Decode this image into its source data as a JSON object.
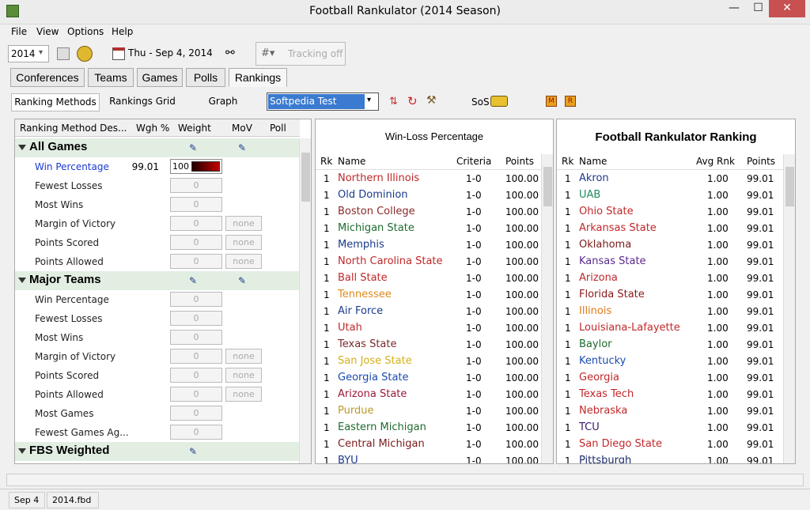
{
  "window": {
    "title": "Football Rankulator  (2014 Season)",
    "min": "—",
    "max": "☐",
    "close": "✕"
  },
  "menu": [
    "File",
    "View",
    "Options",
    "Help"
  ],
  "toolbar": {
    "season": "2014",
    "date": "Thu - Sep 4, 2014",
    "tracking": "Tracking off"
  },
  "main_tabs": [
    "Conferences",
    "Teams",
    "Games",
    "Polls",
    "Rankings"
  ],
  "sub_tabs": [
    "Ranking Methods",
    "Rankings Grid",
    "Graph"
  ],
  "method_select": "Softpedia Test",
  "sos_label": "SoS",
  "methods_header": [
    "Ranking Method Des...",
    "Wgh %",
    "Weight",
    "MoV",
    "Poll"
  ],
  "groups": [
    {
      "name": "All Games",
      "items": [
        {
          "label": "Win Percentage",
          "pct": "99.01",
          "weight": "100",
          "none": false,
          "active": true
        },
        {
          "label": "Fewest Losses",
          "weight": "0",
          "none": false
        },
        {
          "label": "Most Wins",
          "weight": "0",
          "none": false
        },
        {
          "label": "Margin of Victory",
          "weight": "0",
          "none": true
        },
        {
          "label": "Points Scored",
          "weight": "0",
          "none": true
        },
        {
          "label": "Points Allowed",
          "weight": "0",
          "none": true
        }
      ]
    },
    {
      "name": "Major Teams",
      "items": [
        {
          "label": "Win Percentage",
          "weight": "0",
          "none": false
        },
        {
          "label": "Fewest Losses",
          "weight": "0",
          "none": false
        },
        {
          "label": "Most Wins",
          "weight": "0",
          "none": false
        },
        {
          "label": "Margin of Victory",
          "weight": "0",
          "none": true
        },
        {
          "label": "Points Scored",
          "weight": "0",
          "none": true
        },
        {
          "label": "Points Allowed",
          "weight": "0",
          "none": true
        },
        {
          "label": "Most Games",
          "weight": "0",
          "none": false
        },
        {
          "label": "Fewest Games Ag...",
          "weight": "0",
          "none": false
        }
      ]
    },
    {
      "name": "FBS Weighted",
      "items": []
    }
  ],
  "none_label": "none",
  "wl": {
    "title": "Win-Loss Percentage",
    "headers": [
      "Rk",
      "Name",
      "Criteria",
      "Points"
    ],
    "rows": [
      [
        "1",
        "Northern Illinois",
        "1-0",
        "100.00",
        "#c0282a"
      ],
      [
        "1",
        "Old Dominion",
        "1-0",
        "100.00",
        "#1a3a8c"
      ],
      [
        "1",
        "Boston College",
        "1-0",
        "100.00",
        "#8b2a2a"
      ],
      [
        "1",
        "Michigan State",
        "1-0",
        "100.00",
        "#1e6b2e"
      ],
      [
        "1",
        "Memphis",
        "1-0",
        "100.00",
        "#1a3a8c"
      ],
      [
        "1",
        "North Carolina State",
        "1-0",
        "100.00",
        "#c0282a"
      ],
      [
        "1",
        "Ball State",
        "1-0",
        "100.00",
        "#c0282a"
      ],
      [
        "1",
        "Tennessee",
        "1-0",
        "100.00",
        "#e08a1a"
      ],
      [
        "1",
        "Air Force",
        "1-0",
        "100.00",
        "#1a3a8c"
      ],
      [
        "1",
        "Utah",
        "1-0",
        "100.00",
        "#c0282a"
      ],
      [
        "1",
        "Texas State",
        "1-0",
        "100.00",
        "#7a2a2a"
      ],
      [
        "1",
        "San Jose State",
        "1-0",
        "100.00",
        "#d4b01a"
      ],
      [
        "1",
        "Georgia State",
        "1-0",
        "100.00",
        "#1a4ab0"
      ],
      [
        "1",
        "Arizona State",
        "1-0",
        "100.00",
        "#9a1a3a"
      ],
      [
        "1",
        "Purdue",
        "1-0",
        "100.00",
        "#b89a2a"
      ],
      [
        "1",
        "Eastern Michigan",
        "1-0",
        "100.00",
        "#1e6b2e"
      ],
      [
        "1",
        "Central Michigan",
        "1-0",
        "100.00",
        "#7a1a1a"
      ],
      [
        "1",
        "BYU",
        "1-0",
        "100.00",
        "#1a3a8c"
      ]
    ]
  },
  "fr": {
    "title": "Football Rankulator Ranking",
    "headers": [
      "Rk",
      "Name",
      "Avg Rnk",
      "Points"
    ],
    "rows": [
      [
        "1",
        "Akron",
        "1.00",
        "99.01",
        "#1a3a8c"
      ],
      [
        "1",
        "UAB",
        "1.00",
        "99.01",
        "#1e8b5e"
      ],
      [
        "1",
        "Ohio State",
        "1.00",
        "99.01",
        "#c0282a"
      ],
      [
        "1",
        "Arkansas State",
        "1.00",
        "99.01",
        "#c0282a"
      ],
      [
        "1",
        "Oklahoma",
        "1.00",
        "99.01",
        "#7a1a1a"
      ],
      [
        "1",
        "Kansas State",
        "1.00",
        "99.01",
        "#5a2a8c"
      ],
      [
        "1",
        "Arizona",
        "1.00",
        "99.01",
        "#c0282a"
      ],
      [
        "1",
        "Florida State",
        "1.00",
        "99.01",
        "#8b1a1a"
      ],
      [
        "1",
        "Illinois",
        "1.00",
        "99.01",
        "#e07a1a"
      ],
      [
        "1",
        "Louisiana-Lafayette",
        "1.00",
        "99.01",
        "#c0282a"
      ],
      [
        "1",
        "Baylor",
        "1.00",
        "99.01",
        "#1e6b2e"
      ],
      [
        "1",
        "Kentucky",
        "1.00",
        "99.01",
        "#1a4ab0"
      ],
      [
        "1",
        "Georgia",
        "1.00",
        "99.01",
        "#c0282a"
      ],
      [
        "1",
        "Texas Tech",
        "1.00",
        "99.01",
        "#c0282a"
      ],
      [
        "1",
        "Nebraska",
        "1.00",
        "99.01",
        "#c0282a"
      ],
      [
        "1",
        "TCU",
        "1.00",
        "99.01",
        "#3a1a6b"
      ],
      [
        "1",
        "San Diego State",
        "1.00",
        "99.01",
        "#c0282a"
      ],
      [
        "1",
        "Pittsburgh",
        "1.00",
        "99.01",
        "#1a2a6b"
      ]
    ]
  },
  "status": {
    "date": "Sep 4",
    "file": "2014.fbd"
  }
}
